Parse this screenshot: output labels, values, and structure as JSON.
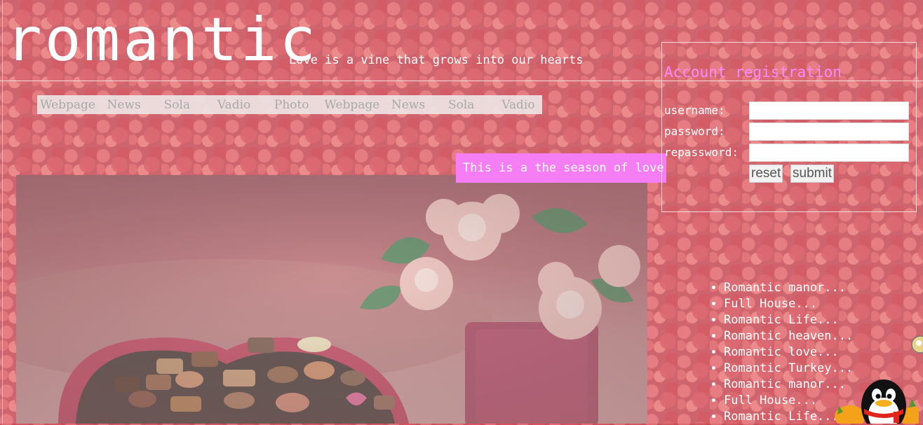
{
  "header": {
    "logo": "romantic",
    "tagline": "Love is a vine that grows into our hearts"
  },
  "nav": {
    "items": [
      "Webpage",
      "News",
      "Sola",
      "Vadio",
      "Photo",
      "Webpage",
      "News",
      "Sola",
      "Vadio"
    ]
  },
  "banner": {
    "season_text": "This is a the season of love"
  },
  "registration": {
    "title": "Account registration",
    "username_label": "username:",
    "password_label": "password:",
    "repassword_label": "repassword:",
    "username_value": "",
    "password_value": "",
    "repassword_value": "",
    "reset_label": "reset",
    "submit_label": "submit"
  },
  "sidebar": {
    "links": [
      "Romantic manor...",
      "Full House...",
      "Romantic Life...",
      "Romantic heaven...",
      "Romantic love...",
      "Romantic Turkey...",
      "Romantic manor...",
      "Full House...",
      "Romantic Life..."
    ]
  },
  "colors": {
    "accent_pink": "#f57ef5",
    "title_pink": "#ff88ff",
    "background_rose": "#c8505a"
  },
  "icons": {
    "hero": "heart-chocolate-box-photo",
    "penguin": "qq-penguin-icon",
    "floating": "float-badge-icon"
  }
}
